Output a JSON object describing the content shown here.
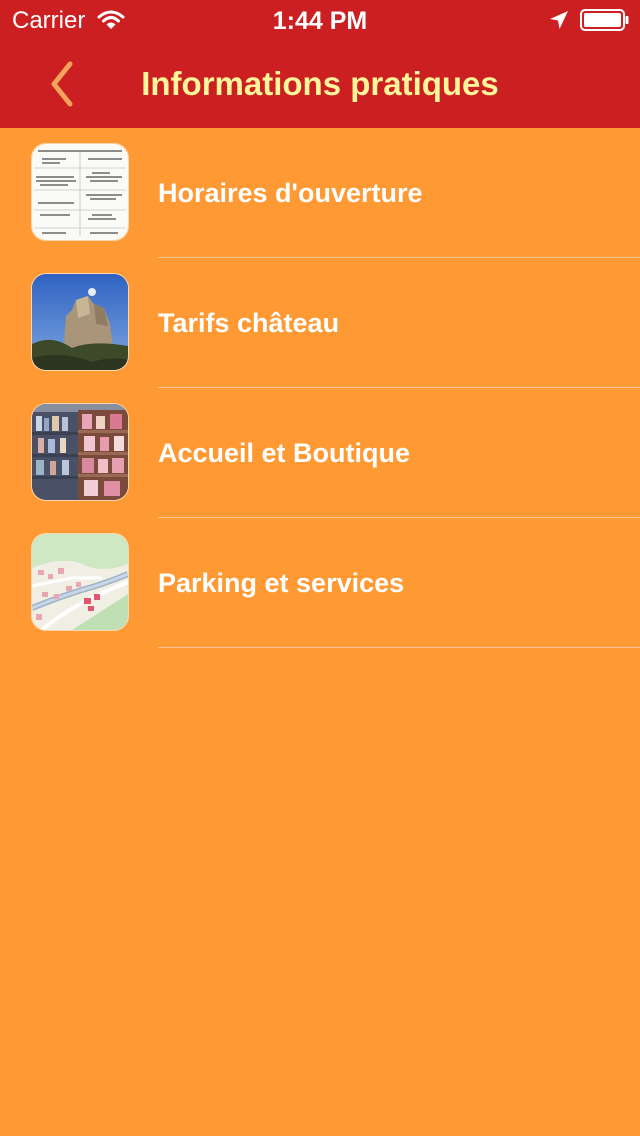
{
  "status_bar": {
    "carrier": "Carrier",
    "time": "1:44 PM",
    "wifi_icon": "wifi-icon",
    "location_icon": "location-arrow-icon",
    "battery_icon": "battery-icon"
  },
  "nav": {
    "title": "Informations pratiques",
    "back_icon": "chevron-left-icon"
  },
  "items": [
    {
      "label": "Horaires d'ouverture",
      "thumbnail": "timetable-document"
    },
    {
      "label": "Tarifs château",
      "thumbnail": "castle-photo"
    },
    {
      "label": "Accueil et Boutique",
      "thumbnail": "shop-shelves-photo"
    },
    {
      "label": "Parking et services",
      "thumbnail": "map-thumbnail"
    }
  ],
  "colors": {
    "nav_background": "#CC1F21",
    "page_background": "#FF9933",
    "title_color": "#FFF59A",
    "row_text": "#FFFFFF",
    "back_chevron": "#F2A25A"
  }
}
